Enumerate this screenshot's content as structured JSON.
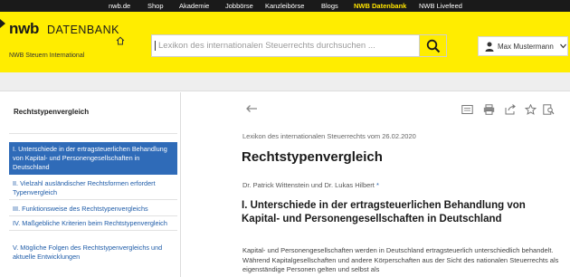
{
  "top_nav": {
    "items": [
      "nwb.de",
      "Shop",
      "Akademie",
      "Jobbörse",
      "Kanzleibörse",
      "Blogs",
      "NWB Datenbank",
      "NWB Livefeed"
    ],
    "active": "NWB Datenbank"
  },
  "header": {
    "logo_primary": "nwb",
    "logo_secondary": "DATENBANK",
    "subtitle": "NWB Steuern International",
    "search": {
      "placeholder": "Lexikon des internationalen Steuerrechts durchsuchen ..."
    },
    "user": {
      "name": "Max Mustermann"
    }
  },
  "sidebar": {
    "title": "Rechtstypenvergleich",
    "toc": [
      {
        "label": "I. Unterschiede in der ertragsteuerlichen Behandlung von Kapital- und Personengesellschaften in Deutschland",
        "active": true
      },
      {
        "label": "II. Vielzahl ausländischer Rechtsformen erfordert Typenvergleich",
        "active": false
      },
      {
        "label": "III. Funktionsweise des Rechtstypenvergleichs",
        "active": false
      },
      {
        "label": "IV. Maßgebliche Kriterien beim Rechtstypenvergleich",
        "active": false
      },
      {
        "label": "V. Mögliche Folgen des Rechtstypenvergleichs und aktuelle Entwicklungen",
        "active": false
      }
    ]
  },
  "document": {
    "meta": "Lexikon des internationalen Steuerrechts vom 26.02.2020",
    "title": "Rechtstypenvergleich",
    "authors": "Dr. Patrick Wittenstein und Dr. Lukas Hilbert",
    "author_mark": "*",
    "section_heading": "I. Unterschiede in der ertragsteuerlichen Behandlung von Kapital- und Personengesellschaften in Deutschland",
    "paragraph": "Kapital- und Personengesellschaften werden in Deutschland ertragsteuerlich unterschiedlich behandelt. Während Kapitalgesellschaften und andere Körperschaften aus der Sicht des nationalen Steuerrechts als eigenständige Personen gelten und selbst als"
  },
  "toolbar_icons": [
    "pdf-icon",
    "print-icon",
    "share-icon",
    "favorite-star-icon",
    "search-in-document-icon"
  ],
  "colors": {
    "brand_yellow": "#ffed00",
    "link_blue": "#1f5ca8",
    "active_blue": "#2f6bb8",
    "topbar": "#1a1a1a"
  }
}
